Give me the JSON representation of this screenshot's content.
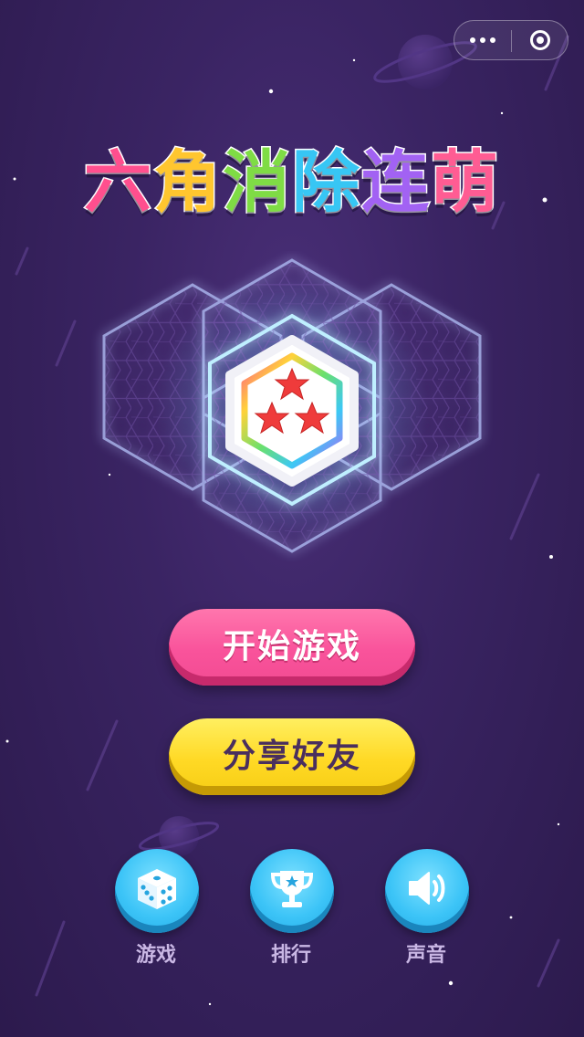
{
  "capsule": {
    "more_icon": "more-dots-icon",
    "close_icon": "close-target-icon"
  },
  "title": {
    "chars": [
      {
        "text": "六",
        "color": "#ff4f8e"
      },
      {
        "text": "角",
        "color": "#ffc62f"
      },
      {
        "text": "消",
        "color": "#7fdc45"
      },
      {
        "text": "除",
        "color": "#37c6f4"
      },
      {
        "text": "连",
        "color": "#a262f3"
      },
      {
        "text": "萌",
        "color": "#ff5c93"
      }
    ]
  },
  "logo": {
    "icon": "three-stars-hexagon-icon"
  },
  "buttons": {
    "start_label": "开始游戏",
    "share_label": "分享好友"
  },
  "bottom": {
    "game": {
      "label": "游戏",
      "icon": "dice-icon"
    },
    "rank": {
      "label": "排行",
      "icon": "trophy-icon"
    },
    "sound": {
      "label": "声音",
      "icon": "speaker-icon"
    }
  },
  "colors": {
    "accent_pink": "#f9539b",
    "accent_yellow": "#ffd925",
    "accent_blue": "#3cc4f7"
  }
}
